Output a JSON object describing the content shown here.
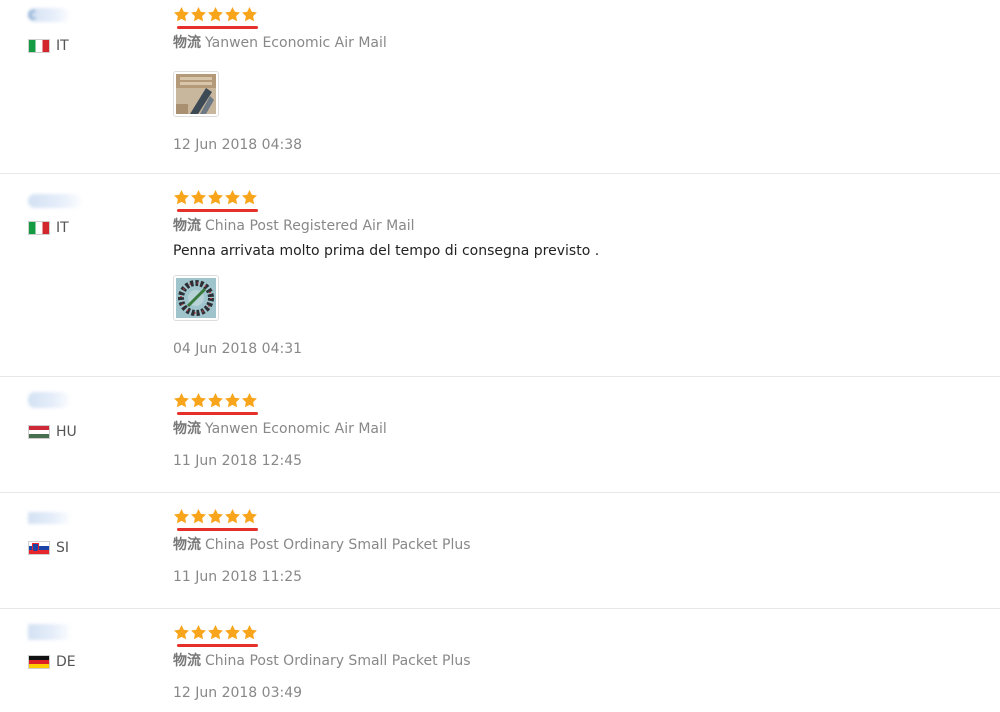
{
  "logistics_label": "物流",
  "star_color": "#f8a51c",
  "underline_color": "#e5302a",
  "reviews": [
    {
      "country": "IT",
      "rating": 5,
      "shipping": "Yanwen Economic Air Mail",
      "feedback": "",
      "photos": 1,
      "date": "12 Jun 2018 04:38"
    },
    {
      "country": "IT",
      "rating": 5,
      "shipping": "China Post Registered Air Mail",
      "feedback": "Penna arrivata molto prima del tempo di consegna previsto .",
      "photos": 1,
      "date": "04 Jun 2018 04:31"
    },
    {
      "country": "HU",
      "rating": 5,
      "shipping": "Yanwen Economic Air Mail",
      "feedback": "",
      "photos": 0,
      "date": "11 Jun 2018 12:45"
    },
    {
      "country": "SI",
      "rating": 5,
      "shipping": "China Post Ordinary Small Packet Plus",
      "feedback": "",
      "photos": 0,
      "date": "11 Jun 2018 11:25"
    },
    {
      "country": "DE",
      "rating": 5,
      "shipping": "China Post Ordinary Small Packet Plus",
      "feedback": "",
      "photos": 0,
      "date": "12 Jun 2018 03:49"
    }
  ]
}
